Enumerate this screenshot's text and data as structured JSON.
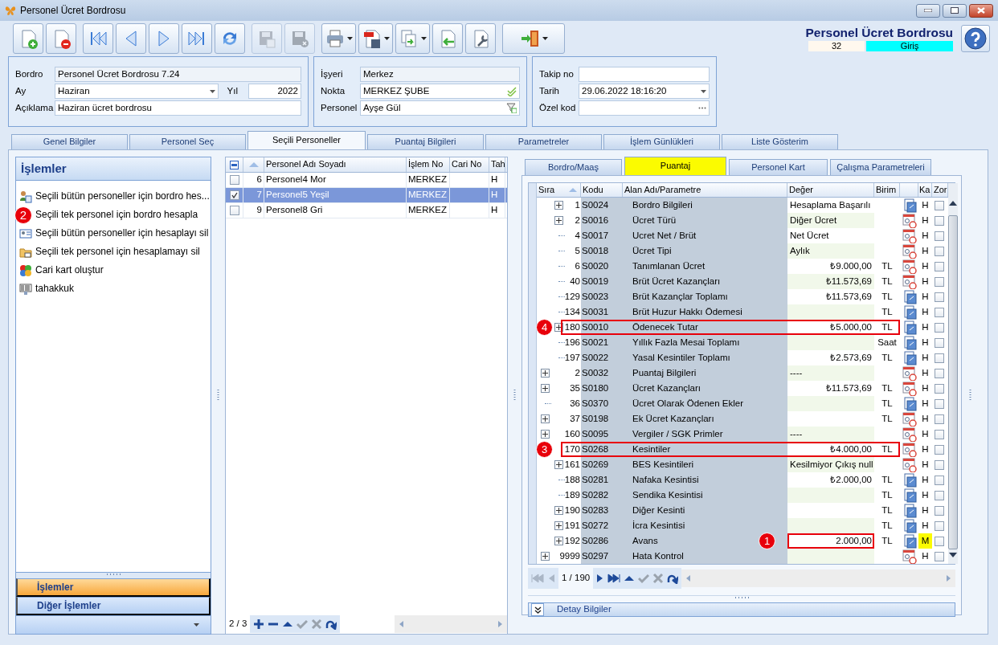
{
  "window": {
    "title": "Personel Ücret Bordrosu"
  },
  "toolbar": {
    "groups": [
      [
        {
          "kind": "new",
          "disabled": false,
          "dropdown": false
        },
        {
          "kind": "delete",
          "disabled": false,
          "dropdown": false
        }
      ],
      [
        {
          "kind": "first",
          "disabled": false,
          "dropdown": false
        },
        {
          "kind": "previous",
          "disabled": false,
          "dropdown": false
        },
        {
          "kind": "next",
          "disabled": false,
          "dropdown": false
        },
        {
          "kind": "last",
          "disabled": false,
          "dropdown": false
        },
        {
          "kind": "refresh",
          "disabled": false,
          "dropdown": false
        }
      ],
      [
        {
          "kind": "save",
          "disabled": true,
          "dropdown": false
        },
        {
          "kind": "cancel",
          "disabled": true,
          "dropdown": false
        }
      ],
      [
        {
          "kind": "print",
          "disabled": false,
          "dropdown": true
        },
        {
          "kind": "pdf",
          "disabled": false,
          "dropdown": true
        },
        {
          "kind": "export",
          "disabled": false,
          "dropdown": true
        },
        {
          "kind": "import",
          "disabled": false,
          "dropdown": false
        },
        {
          "kind": "tools",
          "disabled": false,
          "dropdown": false
        }
      ],
      [
        {
          "kind": "exit",
          "disabled": false,
          "dropdown": true
        }
      ]
    ]
  },
  "header": {
    "title": "Personel Ücret Bordrosu",
    "record": "32",
    "mode": "Giriş"
  },
  "form": {
    "groups": [
      {
        "rows": [
          [
            {
              "label": "Bordro",
              "value": "Personel Ücret Bordrosu 7.24",
              "kind": "readonly"
            }
          ],
          [
            {
              "label": "Ay",
              "value": "Haziran",
              "kind": "combo"
            },
            {
              "label": "Yıl",
              "value": "2022",
              "kind": "number"
            }
          ],
          [
            {
              "label": "Açıklama",
              "value": "Haziran ücret bordrosu",
              "kind": "text"
            }
          ]
        ]
      },
      {
        "rows": [
          [
            {
              "label": "İşyeri",
              "value": "Merkez",
              "kind": "readonly"
            }
          ],
          [
            {
              "label": "Nokta",
              "value": "MERKEZ ŞUBE",
              "kind": "lookup"
            }
          ],
          [
            {
              "label": "Personel",
              "value": "Ayşe Gül",
              "kind": "search"
            }
          ]
        ]
      },
      {
        "rows": [
          [
            {
              "label": "Takip no",
              "kind": "text"
            }
          ],
          [
            {
              "label": "Tarih",
              "value": "29.06.2022 18:16:20",
              "kind": "combo"
            }
          ],
          [
            {
              "label": "Özel kod",
              "kind": "ellipsis"
            }
          ]
        ]
      }
    ]
  },
  "tabs": [
    {
      "label": "Genel Bilgiler",
      "selected": false
    },
    {
      "label": "Personel Seç",
      "selected": false
    },
    {
      "label": "Seçili Personeller",
      "selected": true
    },
    {
      "label": "Puantaj Bilgileri",
      "selected": false
    },
    {
      "label": "Parametreler",
      "selected": false
    },
    {
      "label": "İşlem Günlükleri",
      "selected": false
    },
    {
      "label": "Liste Gösterim",
      "selected": false
    }
  ],
  "actions_panel": {
    "title": "İşlemler",
    "items": [
      {
        "text": "Seçili bütün personeller için bordro hes...",
        "kind": "people"
      },
      {
        "text": "Seçili tek personel için bordro hesapla",
        "callout": "2"
      },
      {
        "text": "Seçili bütün personeller için hesaplayı sil",
        "kind": "card"
      },
      {
        "text": "Seçili tek personel için hesaplamayı sil",
        "kind": "folder"
      },
      {
        "text": "Cari kart oluştur",
        "kind": "coins"
      },
      {
        "text": "tahakkuk",
        "kind": "barcode"
      }
    ],
    "sections": [
      {
        "label": "İşlemler",
        "selected": true
      },
      {
        "label": "Diğer İşlemler",
        "selected": false
      }
    ]
  },
  "personnel_grid": {
    "columns": [
      "Personel Adı Soyadı",
      "İşlem No",
      "Cari No",
      "Tah"
    ],
    "rows": [
      {
        "no": "6",
        "name": "Personel4 Mor",
        "islem": "MERKEZ",
        "tah": "H",
        "checked": false,
        "selected": false
      },
      {
        "no": "7",
        "name": "Personel5 Yeşil",
        "islem": "MERKEZ",
        "tah": "H",
        "checked": true,
        "selected": true
      },
      {
        "no": "9",
        "name": "Personel8 Gri",
        "islem": "MERKEZ",
        "tah": "H",
        "checked": false,
        "selected": false
      }
    ],
    "pager": "2 / 3"
  },
  "detail": {
    "tabs": [
      {
        "label": "Bordro/Maaş",
        "selected": false
      },
      {
        "label": "Puantaj",
        "selected": true
      },
      {
        "label": "Personel Kart",
        "selected": false
      },
      {
        "label": "Çalışma Parametreleri",
        "selected": false
      }
    ],
    "columns": [
      "Sıra",
      "Kodu",
      "Alan Adı/Parametre",
      "Değer",
      "Birim",
      "Ka",
      "Zor"
    ],
    "rows": [
      {
        "children": [
          {
            "sira": "1",
            "kodu": "S0024",
            "name": "Bordro Bilgileri",
            "value": "Hesaplama Başarılı",
            "numeric": false,
            "kind": "manual",
            "ka": "H",
            "highlighted": false,
            "zor": false,
            "expandable": true
          },
          {
            "sira": "2",
            "kodu": "S0016",
            "name": "Ücret Türü",
            "value": "Diğer Ücret",
            "numeric": false,
            "kind": "formula",
            "ka": "H",
            "highlighted": false,
            "zor": false,
            "expandable": true
          },
          {
            "sira": "4",
            "kodu": "S0017",
            "name": "Ucret Net / Brüt",
            "value": "Net Ücret",
            "numeric": false,
            "kind": "formula",
            "ka": "H",
            "highlighted": false,
            "zor": false,
            "expandable": false
          },
          {
            "sira": "5",
            "kodu": "S0018",
            "name": "Ücret Tipi",
            "value": "Aylık",
            "numeric": false,
            "kind": "formula",
            "ka": "H",
            "highlighted": false,
            "zor": false,
            "expandable": false
          },
          {
            "sira": "6",
            "kodu": "S0020",
            "name": "Tanımlanan Ücret",
            "value": "₺9.000,00",
            "unit": "TL",
            "numeric": true,
            "kind": "formula",
            "ka": "H",
            "highlighted": false,
            "zor": false,
            "expandable": false
          },
          {
            "sira": "40",
            "kodu": "S0019",
            "name": "Brüt Ücret Kazançları",
            "value": "₺11.573,69",
            "unit": "TL",
            "numeric": true,
            "kind": "formula",
            "ka": "H",
            "highlighted": false,
            "zor": false,
            "expandable": false
          },
          {
            "sira": "129",
            "kodu": "S0023",
            "name": "Brüt Kazançlar Toplamı",
            "value": "₺11.573,69",
            "unit": "TL",
            "numeric": true,
            "kind": "manual",
            "ka": "H",
            "highlighted": false,
            "zor": false,
            "expandable": false
          },
          {
            "sira": "134",
            "kodu": "S0031",
            "name": "Brüt Huzur Hakkı Ödemesi",
            "unit": "TL",
            "kind": "manual",
            "ka": "H",
            "highlighted": false,
            "zor": false,
            "expandable": false
          },
          {
            "sira": "180",
            "kodu": "S0010",
            "name": "Ödenecek Tutar",
            "value": "₺5.000,00",
            "unit": "TL",
            "numeric": true,
            "kind": "manual",
            "ka": "H",
            "highlighted": false,
            "zor": false,
            "expandable": true,
            "callout": {
              "number": "4",
              "whole_row": true
            }
          },
          {
            "sira": "196",
            "kodu": "S0021",
            "name": "Yıllık Fazla Mesai Toplamı",
            "unit": "Saat",
            "kind": "manual",
            "ka": "H",
            "highlighted": false,
            "zor": false,
            "expandable": false
          },
          {
            "sira": "197",
            "kodu": "S0022",
            "name": "Yasal Kesintiler Toplamı",
            "value": "₺2.573,69",
            "unit": "TL",
            "numeric": true,
            "kind": "manual",
            "ka": "H",
            "highlighted": false,
            "zor": false,
            "expandable": false
          }
        ]
      },
      {
        "sira": "2",
        "kodu": "S0032",
        "name": "Puantaj Bilgileri",
        "value": "----",
        "numeric": false,
        "kind": "formula",
        "ka": "H",
        "highlighted": false,
        "zor": false,
        "expandable": true
      },
      {
        "sira": "35",
        "kodu": "S0180",
        "name": "Ücret Kazançları",
        "value": "₺11.573,69",
        "unit": "TL",
        "numeric": true,
        "kind": "formula",
        "ka": "H",
        "highlighted": false,
        "zor": false,
        "expandable": true
      },
      {
        "sira": "36",
        "kodu": "S0370",
        "name": "Ücret Olarak Ödenen Ekler",
        "unit": "TL",
        "kind": "manual",
        "ka": "H",
        "highlighted": false,
        "zor": false,
        "expandable": false
      },
      {
        "sira": "37",
        "kodu": "S0198",
        "name": "Ek Ücret Kazançları",
        "unit": "TL",
        "kind": "formula",
        "ka": "H",
        "highlighted": false,
        "zor": false,
        "expandable": true
      },
      {
        "sira": "160",
        "kodu": "S0095",
        "name": "Vergiler / SGK Primler",
        "value": "----",
        "numeric": false,
        "kind": "formula",
        "ka": "H",
        "highlighted": false,
        "zor": false,
        "expandable": true
      },
      {
        "sira": "170",
        "kodu": "S0268",
        "name": "Kesintiler",
        "value": "₺4.000,00",
        "unit": "TL",
        "numeric": true,
        "kind": "formula",
        "ka": "H",
        "highlighted": false,
        "zor": false,
        "expandable": false,
        "callout": {
          "number": "3",
          "whole_row": true
        },
        "children": [
          {
            "sira": "161",
            "kodu": "S0269",
            "name": "BES Kesintileri",
            "value": "Kesilmiyor Çıkış null",
            "numeric": false,
            "kind": "formula",
            "ka": "H",
            "highlighted": false,
            "zor": false,
            "expandable": true
          },
          {
            "sira": "188",
            "kodu": "S0281",
            "name": "Nafaka Kesintisi",
            "value": "₺2.000,00",
            "unit": "TL",
            "numeric": true,
            "kind": "manual",
            "ka": "H",
            "highlighted": false,
            "zor": false,
            "expandable": false
          },
          {
            "sira": "189",
            "kodu": "S0282",
            "name": "Sendika Kesintisi",
            "unit": "TL",
            "kind": "manual",
            "ka": "H",
            "highlighted": false,
            "zor": false,
            "expandable": false
          },
          {
            "sira": "190",
            "kodu": "S0283",
            "name": "Diğer Kesinti",
            "unit": "TL",
            "kind": "manual",
            "ka": "H",
            "highlighted": false,
            "zor": false,
            "expandable": true
          },
          {
            "sira": "191",
            "kodu": "S0272",
            "name": "İcra Kesintisi",
            "unit": "TL",
            "kind": "manual",
            "ka": "H",
            "highlighted": false,
            "zor": false,
            "expandable": true
          },
          {
            "sira": "192",
            "kodu": "S0286",
            "name": "Avans",
            "value": "2.000,00",
            "unit": "TL",
            "numeric": true,
            "kind": "manual",
            "ka": "M",
            "highlighted": true,
            "zor": false,
            "expandable": true,
            "callout": {
              "number": "1",
              "whole_row": false
            }
          }
        ]
      },
      {
        "sira": "9999",
        "kodu": "S0297",
        "name": "Hata Kontrol",
        "kind": "formula",
        "ka": "H",
        "highlighted": false,
        "zor": false,
        "expandable": true
      }
    ],
    "pager": "1 / 190",
    "footer": "Detay Bilgiler"
  }
}
